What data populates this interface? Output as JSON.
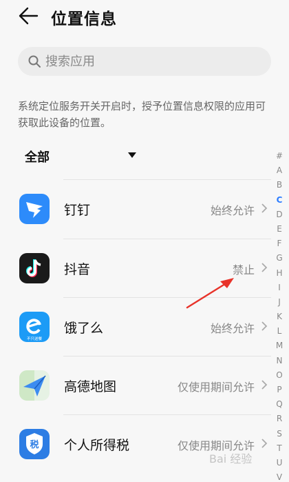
{
  "header": {
    "title": "位置信息",
    "back_icon": "arrow-left-icon"
  },
  "search": {
    "placeholder": "搜索应用",
    "icon": "search-icon"
  },
  "description": "系统定位服务开关开启时，授予位置信息权限的应用可获取此设备的位置。",
  "filter": {
    "label": "全部",
    "icon": "caret-down-icon"
  },
  "apps": [
    {
      "name": "钉钉",
      "permission": "始终允许",
      "icon": "dingtalk-icon",
      "color": "#2d8bfa"
    },
    {
      "name": "抖音",
      "permission": "禁止",
      "icon": "douyin-icon",
      "color": "#1a1a1a"
    },
    {
      "name": "饿了么",
      "permission": "始终允许",
      "icon": "eleme-icon",
      "color": "#1c9bf6",
      "icon_caption": "不只送餐"
    },
    {
      "name": "高德地图",
      "permission": "仅使用期间允许",
      "icon": "amap-icon",
      "color": "#3c8cf0"
    },
    {
      "name": "个人所得税",
      "permission": "仅使用期间允许",
      "icon": "tax-icon",
      "color": "#2d7de4",
      "icon_text": "税"
    }
  ],
  "index_letters": [
    "#",
    "A",
    "B",
    "C",
    "D",
    "E",
    "F",
    "G",
    "H",
    "I",
    "J",
    "K",
    "L",
    "M",
    "N",
    "O",
    "P",
    "Q",
    "R",
    "S",
    "T",
    "U",
    "V"
  ],
  "index_active": "C",
  "watermark": "Bai 经验",
  "annotation": {
    "icon": "red-arrow-icon",
    "color": "#e8332a"
  }
}
